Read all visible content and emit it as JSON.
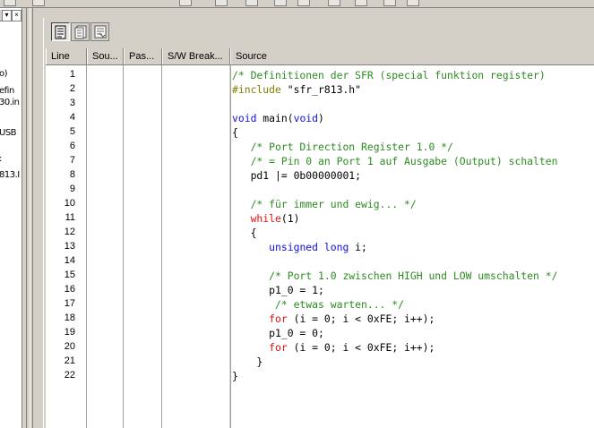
{
  "left_panel": {
    "items": [
      "o)",
      "efin",
      "30.in",
      "USB",
      ":",
      "813.I"
    ]
  },
  "toolbar": {
    "buttons": [
      "source-view-icon",
      "mixed-view-icon",
      "disassembly-view-icon"
    ]
  },
  "columns": [
    "Line",
    "Sou...",
    "Pas...",
    "S/W Break...",
    "Source"
  ],
  "line_numbers": [
    "1",
    "2",
    "3",
    "4",
    "5",
    "6",
    "7",
    "8",
    "9",
    "10",
    "11",
    "12",
    "13",
    "14",
    "15",
    "16",
    "17",
    "18",
    "19",
    "20",
    "21",
    "22"
  ],
  "code_lines": [
    [
      {
        "t": "/* Definitionen der SFR (special funktion register)",
        "c": "cmt"
      }
    ],
    [
      {
        "t": "#include",
        "c": "pp"
      },
      {
        "t": " \"sfr_r813.h\"",
        "c": "id"
      }
    ],
    [],
    [
      {
        "t": "void",
        "c": "kw"
      },
      {
        "t": " main(",
        "c": "id"
      },
      {
        "t": "void",
        "c": "kw"
      },
      {
        "t": ")",
        "c": "id"
      }
    ],
    [
      {
        "t": "{",
        "c": "id"
      }
    ],
    [
      {
        "t": "   /* Port Direction Register 1.0 */",
        "c": "cmt"
      }
    ],
    [
      {
        "t": "   /* = Pin 0 an Port 1 auf Ausgabe (Output) schalten",
        "c": "cmt"
      }
    ],
    [
      {
        "t": "   pd1 |= 0b00000001;",
        "c": "id"
      }
    ],
    [],
    [
      {
        "t": "   /* für immer und ewig... */",
        "c": "cmt"
      }
    ],
    [
      {
        "t": "   ",
        "c": "id"
      },
      {
        "t": "while",
        "c": "kr"
      },
      {
        "t": "(1)",
        "c": "id"
      }
    ],
    [
      {
        "t": "   {",
        "c": "id"
      }
    ],
    [
      {
        "t": "      ",
        "c": "id"
      },
      {
        "t": "unsigned long",
        "c": "kw"
      },
      {
        "t": " i;",
        "c": "id"
      }
    ],
    [],
    [
      {
        "t": "      /* Port 1.0 zwischen HIGH und LOW umschalten */",
        "c": "cmt"
      }
    ],
    [
      {
        "t": "      p1_0 = 1;",
        "c": "id"
      }
    ],
    [
      {
        "t": "       /* etwas warten... */",
        "c": "cmt"
      }
    ],
    [
      {
        "t": "      ",
        "c": "id"
      },
      {
        "t": "for",
        "c": "kr"
      },
      {
        "t": " (i = 0; i < 0xFE; i++);",
        "c": "id"
      }
    ],
    [
      {
        "t": "      p1_0 = 0;",
        "c": "id"
      }
    ],
    [
      {
        "t": "      ",
        "c": "id"
      },
      {
        "t": "for",
        "c": "kr"
      },
      {
        "t": " (i = 0; i < 0xFE; i++);",
        "c": "id"
      }
    ],
    [
      {
        "t": "    }",
        "c": "id"
      }
    ],
    [
      {
        "t": "}",
        "c": "id"
      }
    ]
  ]
}
